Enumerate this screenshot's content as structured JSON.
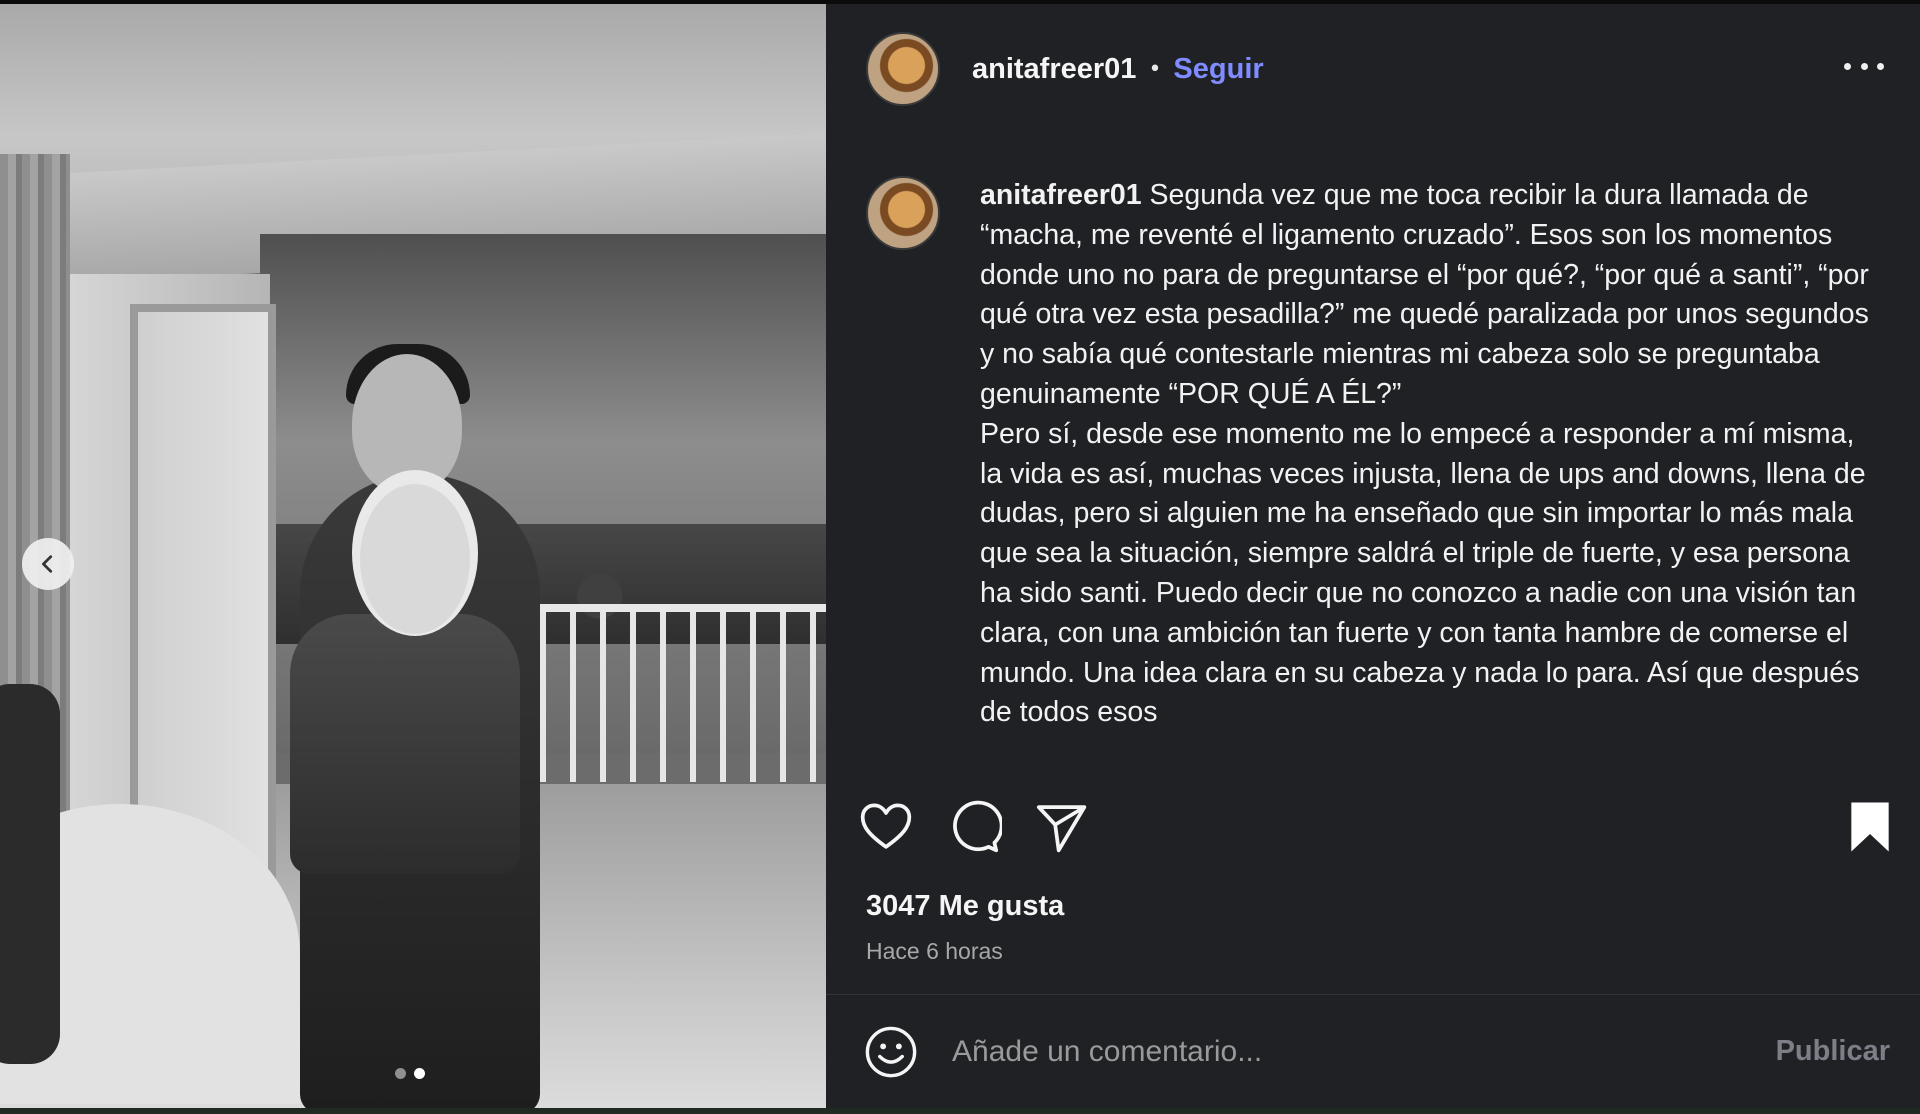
{
  "header": {
    "username": "anitafreer01",
    "separator": "•",
    "follow_label": "Seguir",
    "more_icon": "more-horizontal-icon"
  },
  "caption": {
    "username": "anitafreer01",
    "text": " Segunda vez que me toca recibir la dura llamada de “macha, me reventé el ligamento cruzado”. Esos son los momentos donde uno no para de preguntarse el “por qué?, “por qué a santi”, “por qué otra vez esta pesadilla?” me quedé paralizada por unos segundos y no sabía qué contestarle mientras mi cabeza solo se preguntaba genuinamente “POR QUÉ A ÉL?”\nPero sí, desde ese momento me lo empecé a responder a mí misma, la vida es así, muchas veces injusta, llena de ups and downs, llena de dudas, pero si alguien me ha enseñado que sin importar lo más mala que sea la situación, siempre saldrá el triple de fuerte, y esa persona ha sido santi. Puedo decir que no conozco a nadie con una visión tan clara, con una ambición tan fuerte y con tanta hambre de comerse el mundo. Una idea clara en su cabeza y nada lo para. Así que después de todos esos"
  },
  "stats": {
    "likes": "3047 Me gusta",
    "time_ago": "Hace 6 horas"
  },
  "actions": {
    "like_icon": "heart-icon",
    "comment_icon": "comment-icon",
    "share_icon": "send-icon",
    "save_icon": "bookmark-icon"
  },
  "comment": {
    "placeholder": "Añade un comentario...",
    "publish_label": "Publicar"
  },
  "carousel": {
    "total_slides": 2,
    "active_slide": 2
  },
  "colors": {
    "panel_bg": "#202125",
    "follow_blue": "#7f8cff",
    "muted_text": "#a8a8a8"
  }
}
